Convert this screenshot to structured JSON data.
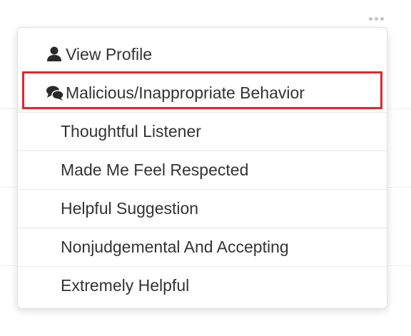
{
  "header": {
    "more_icon": "more-horizontal-icon"
  },
  "menu": {
    "items": [
      {
        "label": "View Profile",
        "icon": "user-icon"
      },
      {
        "label": "Malicious/Inappropriate Behavior",
        "icon": "chat-bubbles-icon",
        "highlighted": true
      },
      {
        "label": "Thoughtful Listener"
      },
      {
        "label": "Made Me Feel Respected"
      },
      {
        "label": "Helpful Suggestion"
      },
      {
        "label": "Nonjudgemental And Accepting"
      },
      {
        "label": "Extremely Helpful"
      }
    ]
  },
  "colors": {
    "highlight_border": "#e5252a",
    "text": "#333333",
    "dots": "#c4c4c4"
  }
}
